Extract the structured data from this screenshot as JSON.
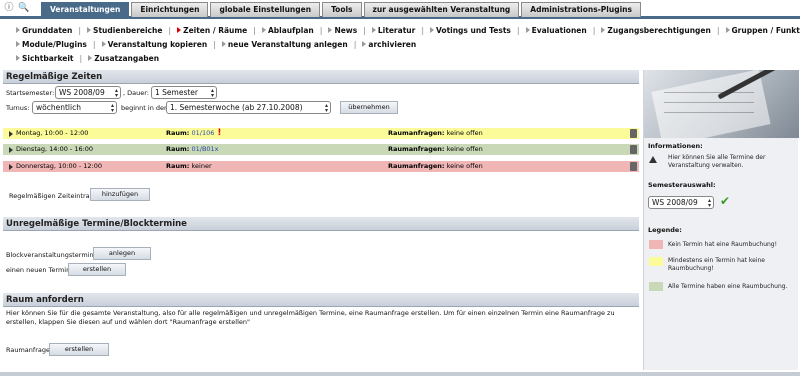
{
  "top_icons": {
    "info": "ⓘ",
    "search": "🔍"
  },
  "tabs": [
    "Veranstaltungen",
    "Einrichtungen",
    "globale Einstellungen",
    "Tools",
    "zur ausgewählten Veranstaltung",
    "Administrations-Plugins"
  ],
  "subnav": {
    "row1": [
      "Grunddaten",
      "Studienbereiche",
      "Zeiten / Räume",
      "Ablaufplan",
      "News",
      "Literatur",
      "Votings und Tests",
      "Evaluationen",
      "Zugangsberechtigungen",
      "Gruppen / Funktionen"
    ],
    "row2": [
      "Module/Plugins",
      "Veranstaltung kopieren",
      "neue Veranstaltung anlegen",
      "archivieren"
    ],
    "row3": [
      "Sichtbarkeit",
      "Zusatzangaben"
    ]
  },
  "section_regular": {
    "title": "Regelmäßige Zeiten",
    "startsemester_label": "Startsemester:",
    "startsemester_value": "WS 2008/09",
    "dauer_label": ", Dauer:",
    "dauer_value": "1 Semester",
    "turnus_label": "Turnus:",
    "turnus_value": "wöchentlich",
    "beginnt_label": "beginnt in der:",
    "beginnt_value": "1. Semesterwoche (ab 27.10.2008)",
    "apply_button": "übernehmen",
    "rows": [
      {
        "time": "Montag, 10:00 - 12:00",
        "raum_label": "Raum:",
        "raum_value": "01/106",
        "warn": "!",
        "rfrag_label": "Raumanfragen:",
        "rfrag_value": "keine offen",
        "color": "#fbfb9a"
      },
      {
        "time": "Dienstag, 14:00 - 16:00",
        "raum_label": "Raum:",
        "raum_value": "01/B01x",
        "warn": "",
        "rfrag_label": "Raumanfragen:",
        "rfrag_value": "keine offen",
        "color": "#c9d8b6"
      },
      {
        "time": "Donnerstag, 10:00 - 12:00",
        "raum_label": "Raum:",
        "raum_value": "keiner",
        "warn": "",
        "rfrag_label": "Raumanfragen:",
        "rfrag_value": "keine offen",
        "color": "#f0b6b6"
      }
    ],
    "add_label": "Regelmäßigen Zeiteintrag",
    "add_button": "hinzufügen"
  },
  "section_irregular": {
    "title": "Unregelmäßige Termine/Blocktermine",
    "block_label": "Blockveranstaltungstermine",
    "block_button": "anlegen",
    "new_label": "einen neuen Termin",
    "new_button": "erstellen"
  },
  "section_raum": {
    "title": "Raum anfordern",
    "text": "Hier können Sie für die gesamte Veranstaltung, also für alle regelmäßigen und unregelmäßigen Termine, eine Raumanfrage erstellen. Um für einen einzelnen Termin eine Raumanfrage zu erstellen, klappen Sie diesen auf und wählen dort \"Raumanfrage erstellen\"",
    "label": "Raumanfrage",
    "button": "erstellen"
  },
  "sidebar": {
    "info_title": "Informationen:",
    "info_text": "Hier können Sie alle Termine der Veranstaltung verwalten.",
    "semester_title": "Semesterauswahl:",
    "semester_value": "WS 2008/09",
    "legend_title": "Legende:",
    "legend": [
      {
        "color": "#f0b6b6",
        "text": "Kein Termin hat eine Raumbuchung!"
      },
      {
        "color": "#fbfb9a",
        "text": "Mindestens ein Termin hat keine Raumbuchung!"
      },
      {
        "color": "#c9d8b6",
        "text": "Alle Termine haben eine Raumbuchung."
      }
    ]
  }
}
